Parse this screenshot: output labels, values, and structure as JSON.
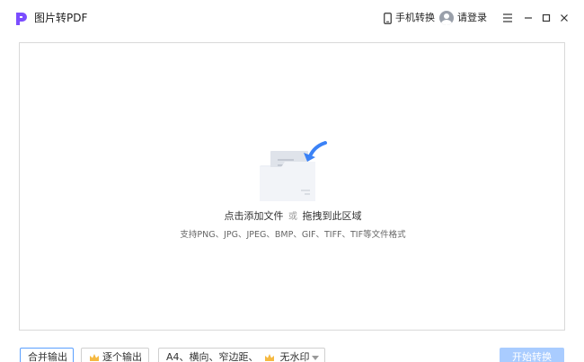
{
  "app": {
    "title": "图片转PDF",
    "accent": "#7b4dff"
  },
  "toolbar": {
    "mobile_label": "手机转换",
    "login_label": "请登录"
  },
  "dropzone": {
    "primary_left": "点击添加文件",
    "or": "或",
    "primary_right": "拖拽到此区域",
    "formats": "支持PNG、JPG、JPEG、BMP、GIF、TIFF、TIF等文件格式"
  },
  "options": {
    "merge_label": "合并输出",
    "single_label": "逐个输出",
    "paper": "A4、横向、窄边距、",
    "watermark": "无水印"
  },
  "start_label": "开始转换",
  "colors": {
    "accent_blue": "#3b82f6",
    "start_disabled": "#a9ccff"
  }
}
